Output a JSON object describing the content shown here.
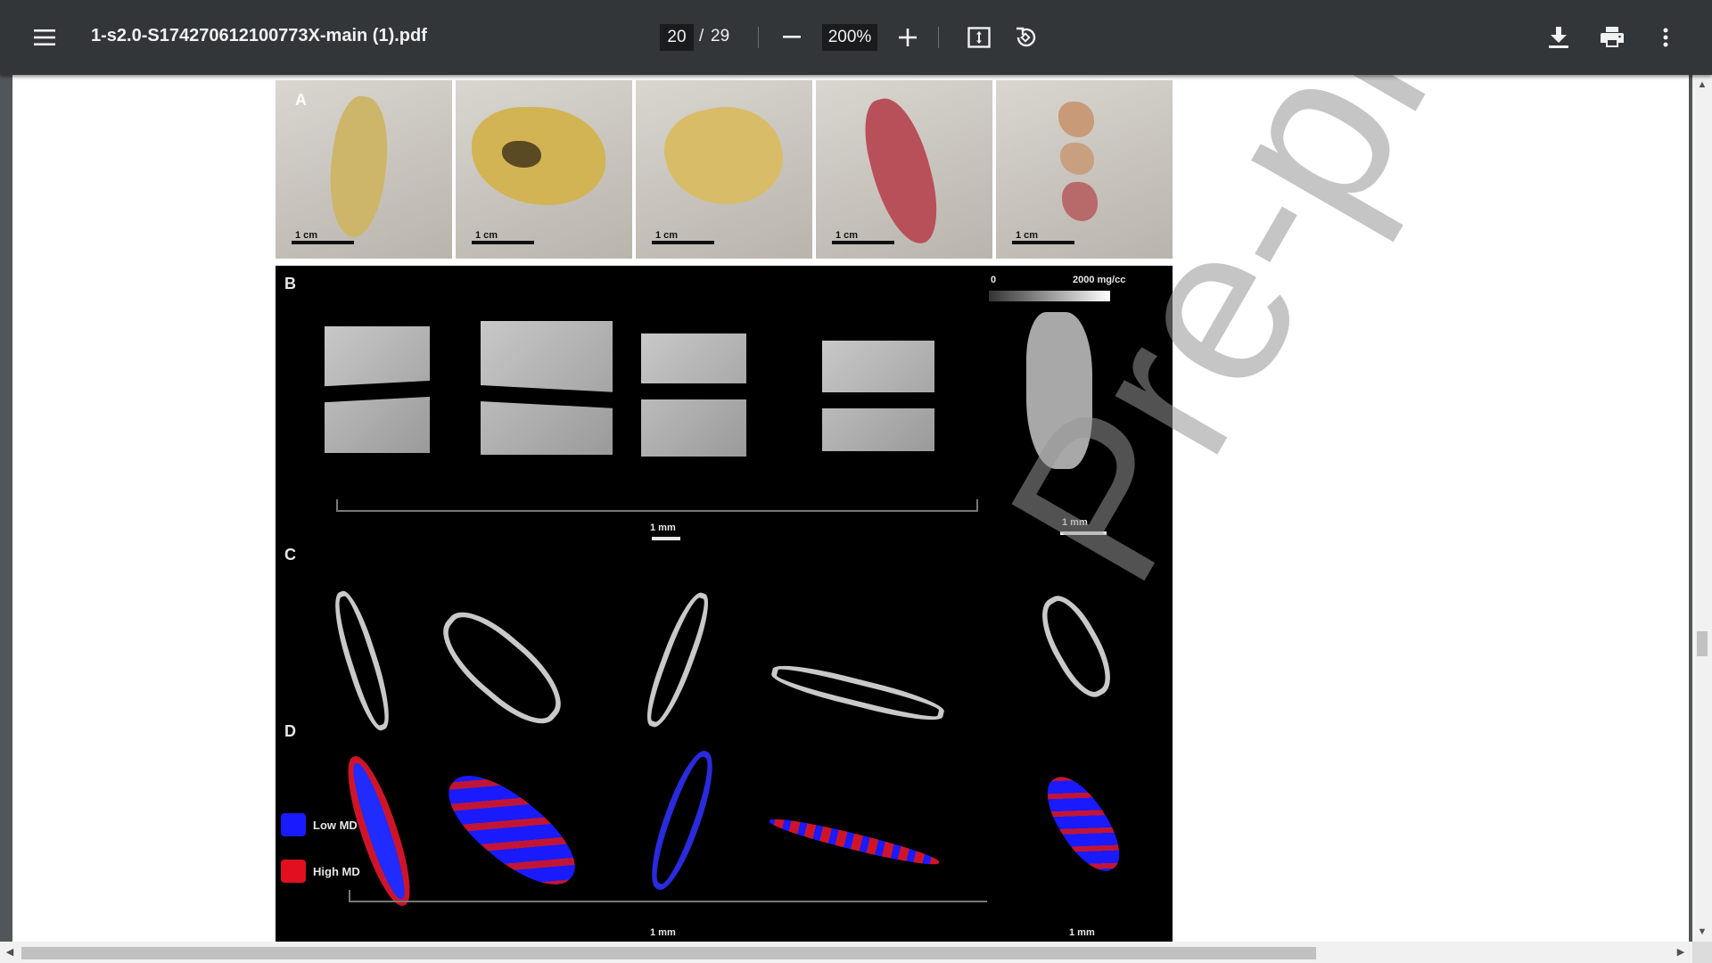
{
  "toolbar": {
    "title": "1-s2.0-S174270612100773X-main (1).pdf",
    "page_current": "20",
    "page_separator": "/",
    "page_total": "29",
    "zoom": "200%",
    "icons": {
      "menu": "hamburger-menu-icon",
      "zoom_out": "minus-icon",
      "zoom_in": "plus-icon",
      "fit": "fit-to-page-icon",
      "rotate": "rotate-counterclockwise-icon",
      "download": "download-icon",
      "print": "print-icon",
      "more": "more-vert-icon"
    }
  },
  "figure": {
    "panel_a": {
      "letter": "A",
      "scale_labels": [
        "1 cm",
        "1 cm",
        "1 cm",
        "1 cm",
        "1 cm"
      ]
    },
    "panel_b": {
      "letter": "B",
      "colorbar_min": "0",
      "colorbar_max": "2000 mg/cc",
      "scale_label_main": "1 mm",
      "scale_label_side": "1 mm"
    },
    "panel_c": {
      "letter": "C"
    },
    "panel_d": {
      "letter": "D",
      "legend_low": "Low MD",
      "legend_high": "High MD",
      "scale_label_main": "1 mm",
      "scale_label_side": "1 mm"
    }
  },
  "watermark": "Pre-proof",
  "colors": {
    "toolbar_bg": "#323639",
    "low_md": "#1a1aff",
    "high_md": "#e01020"
  }
}
